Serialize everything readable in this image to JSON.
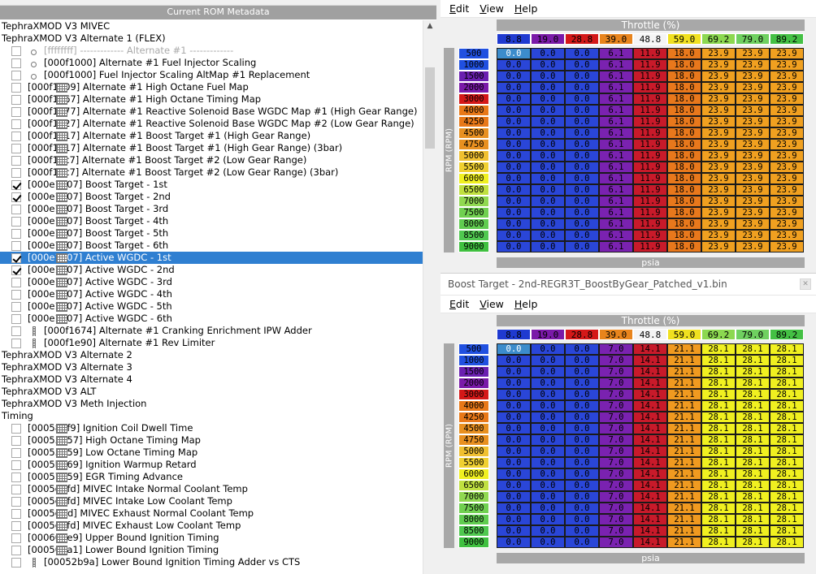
{
  "left_panel": {
    "title": "Current ROM Metadata",
    "rows": [
      {
        "type": "group",
        "text": "TephraXMOD V3 MIVEC"
      },
      {
        "type": "group",
        "text": "TephraXMOD V3 Alternate 1 (FLEX)"
      },
      {
        "type": "item",
        "icon": "dot-icon",
        "checked": false,
        "text": "[ffffffff] ------------- Alternate #1 -------------",
        "dim": true
      },
      {
        "type": "item",
        "icon": "dot-icon",
        "checked": false,
        "text": "[000f1000] Alternate #1 Fuel Injector Scaling"
      },
      {
        "type": "item",
        "icon": "dot-icon",
        "checked": false,
        "text": "[000f1000] Fuel Injector Scaling AltMap #1 Replacement"
      },
      {
        "type": "item",
        "icon": "grid-icon",
        "checked": false,
        "text": "[000f1009] Alternate #1 High Octane Fuel Map"
      },
      {
        "type": "item",
        "icon": "grid-icon",
        "checked": false,
        "text": "[000f1167] Alternate #1 High Octane Timing Map"
      },
      {
        "type": "item",
        "icon": "grid-icon",
        "checked": false,
        "text": "[000f1377] Alternate #1 Reactive Solenoid Base WGDC Map #1 (High Gear Range)"
      },
      {
        "type": "item",
        "icon": "grid-icon",
        "checked": false,
        "text": "[000f1427] Alternate #1 Reactive Solenoid Base WGDC Map #2 (Low Gear Range)"
      },
      {
        "type": "item",
        "icon": "grid-icon",
        "checked": false,
        "text": "[000f1517] Alternate #1 Boost Target #1 (High Gear Range)"
      },
      {
        "type": "item",
        "icon": "grid-icon",
        "checked": false,
        "text": "[000f1517] Alternate #1 Boost Target #1 (High Gear Range) (3bar)"
      },
      {
        "type": "item",
        "icon": "grid-icon",
        "checked": false,
        "text": "[000f15c7] Alternate #1 Boost Target #2 (Low Gear Range)"
      },
      {
        "type": "item",
        "icon": "grid-icon",
        "checked": false,
        "text": "[000f15c7] Alternate #1 Boost Target #2 (Low Gear Range) (3bar)"
      },
      {
        "type": "item",
        "icon": "grid-icon",
        "checked": true,
        "text": "[000e1007] Boost Target - 1st"
      },
      {
        "type": "item",
        "icon": "grid-icon",
        "checked": true,
        "text": "[000e1107] Boost Target - 2nd"
      },
      {
        "type": "item",
        "icon": "grid-icon",
        "checked": false,
        "text": "[000e1207] Boost Target - 3rd"
      },
      {
        "type": "item",
        "icon": "grid-icon",
        "checked": false,
        "text": "[000e1307] Boost Target - 4th"
      },
      {
        "type": "item",
        "icon": "grid-icon",
        "checked": false,
        "text": "[000e1407] Boost Target - 5th"
      },
      {
        "type": "item",
        "icon": "grid-icon",
        "checked": false,
        "text": "[000e1507] Boost Target - 6th"
      },
      {
        "type": "item",
        "icon": "grid-icon",
        "checked": true,
        "selected": true,
        "text": "[000e1607] Active WGDC - 1st"
      },
      {
        "type": "item",
        "icon": "grid-icon",
        "checked": true,
        "text": "[000e1707] Active WGDC - 2nd"
      },
      {
        "type": "item",
        "icon": "grid-icon",
        "checked": false,
        "text": "[000e1807] Active WGDC - 3rd"
      },
      {
        "type": "item",
        "icon": "grid-icon",
        "checked": false,
        "text": "[000e1907] Active WGDC - 4th"
      },
      {
        "type": "item",
        "icon": "grid-icon",
        "checked": false,
        "text": "[000e1a07] Active WGDC - 5th"
      },
      {
        "type": "item",
        "icon": "grid-icon",
        "checked": false,
        "text": "[000e1b07] Active WGDC - 6th"
      },
      {
        "type": "item",
        "icon": "bar-icon",
        "checked": false,
        "text": "[000f1674] Alternate #1 Cranking Enrichment IPW Adder"
      },
      {
        "type": "item",
        "icon": "bar-icon",
        "checked": false,
        "text": "[000f1e90] Alternate #1 Rev Limiter"
      },
      {
        "type": "group",
        "text": "TephraXMOD V3 Alternate 2"
      },
      {
        "type": "group",
        "text": "TephraXMOD V3 Alternate 3"
      },
      {
        "type": "group",
        "text": "TephraXMOD V3 Alternate 4"
      },
      {
        "type": "group",
        "text": "TephraXMOD V3 ALT"
      },
      {
        "type": "group",
        "text": "TephraXMOD V3 Meth Injection"
      },
      {
        "type": "group",
        "text": "Timing"
      },
      {
        "type": "item",
        "icon": "grid-icon",
        "checked": false,
        "text": "[000585f9] Ignition Coil Dwell Time"
      },
      {
        "type": "item",
        "icon": "grid-icon",
        "checked": false,
        "text": "[00055957] High Octane Timing Map"
      },
      {
        "type": "item",
        "icon": "grid-icon",
        "checked": false,
        "text": "[00055b59] Low Octane Timing Map"
      },
      {
        "type": "item",
        "icon": "grid-icon",
        "checked": false,
        "text": "[0005b969] Ignition Warmup Retard"
      },
      {
        "type": "item",
        "icon": "grid-icon",
        "checked": false,
        "text": "[00057359] EGR Timing Advance"
      },
      {
        "type": "item",
        "icon": "grid-icon",
        "checked": false,
        "text": "[0005dbfd] MIVEC Intake Normal Coolant Temp"
      },
      {
        "type": "item",
        "icon": "grid-icon",
        "checked": false,
        "text": "[0005ddfd] MIVEC Intake Low Coolant Temp"
      },
      {
        "type": "item",
        "icon": "grid-icon",
        "checked": false,
        "text": "[0005dffd] MIVEC Exhaust Normal Coolant Temp"
      },
      {
        "type": "item",
        "icon": "grid-icon",
        "checked": false,
        "text": "[0005e1fd] MIVEC Exhaust Low Coolant Temp"
      },
      {
        "type": "item",
        "icon": "grid-icon",
        "checked": false,
        "text": "[000608e9] Upper Bound Ignition Timing"
      },
      {
        "type": "item",
        "icon": "grid-icon",
        "checked": false,
        "text": "[000507a1] Lower Bound Ignition Timing"
      },
      {
        "type": "item",
        "icon": "bar-icon",
        "checked": false,
        "text": "[00052b9a] Lower Bound Ignition Timing Adder vs CTS"
      }
    ]
  },
  "menus": [
    "Edit",
    "View",
    "Help"
  ],
  "table1": {
    "title": "",
    "x_title": "Throttle (%)",
    "y_title": "RPM (RPM)",
    "z_title": "psia",
    "x": [
      "8.8",
      "19.0",
      "28.8",
      "39.0",
      "48.8",
      "59.0",
      "69.2",
      "79.0",
      "89.2"
    ],
    "y": [
      "500",
      "1000",
      "1500",
      "2000",
      "3000",
      "4000",
      "4250",
      "4500",
      "4750",
      "5000",
      "5500",
      "6000",
      "6500",
      "7000",
      "7500",
      "8000",
      "8500",
      "9000"
    ],
    "row_values": [
      "0.0",
      "0.0",
      "0.0",
      "6.1",
      "11.9",
      "18.0",
      "23.9",
      "23.9",
      "23.9"
    ]
  },
  "table2": {
    "title": "Boost Target - 2nd-REGR3T_BoostByGear_Patched_v1.bin",
    "x_title": "Throttle (%)",
    "y_title": "RPM (RPM)",
    "z_title": "psia",
    "x": [
      "8.8",
      "19.0",
      "28.8",
      "39.0",
      "48.8",
      "59.0",
      "69.2",
      "79.0",
      "89.2"
    ],
    "y": [
      "500",
      "1000",
      "1500",
      "2000",
      "3000",
      "4000",
      "4250",
      "4500",
      "4750",
      "5000",
      "5500",
      "6000",
      "6500",
      "7000",
      "7500",
      "8000",
      "8500",
      "9000"
    ],
    "row_values": [
      "0.0",
      "0.0",
      "0.0",
      "7.0",
      "14.1",
      "21.1",
      "28.1",
      "28.1",
      "28.1"
    ]
  },
  "colors": {
    "x_header": [
      "#1f3ad0",
      "#7a1aa8",
      "#d41818",
      "#e8841c",
      "#f4f4f4",
      "#f0e020",
      "#8cd850",
      "#6fd060",
      "#44c044"
    ],
    "y_header": [
      "#2050e0",
      "#2050e0",
      "#6a1fb0",
      "#7a1aa8",
      "#d41818",
      "#e87818",
      "#e87818",
      "#e89020",
      "#e89020",
      "#f0c030",
      "#f0d030",
      "#f0f020",
      "#c0e040",
      "#90d850",
      "#70d050",
      "#60cc50",
      "#50c850",
      "#40c040"
    ],
    "t1_cells": [
      "#2a46d8",
      "#2a46d8",
      "#2a46d8",
      "#7a22b0",
      "#c81a2a",
      "#e8781c",
      "#f0a020",
      "#f0a020",
      "#f0a020"
    ],
    "t1_first": "#3c8ccc",
    "t2_cells": [
      "#2a46d8",
      "#2a46d8",
      "#2a46d8",
      "#7a22b0",
      "#c81a2a",
      "#f09a20",
      "#f0f020",
      "#f0f020",
      "#f0f020"
    ],
    "t2_first": "#3c8ccc"
  }
}
